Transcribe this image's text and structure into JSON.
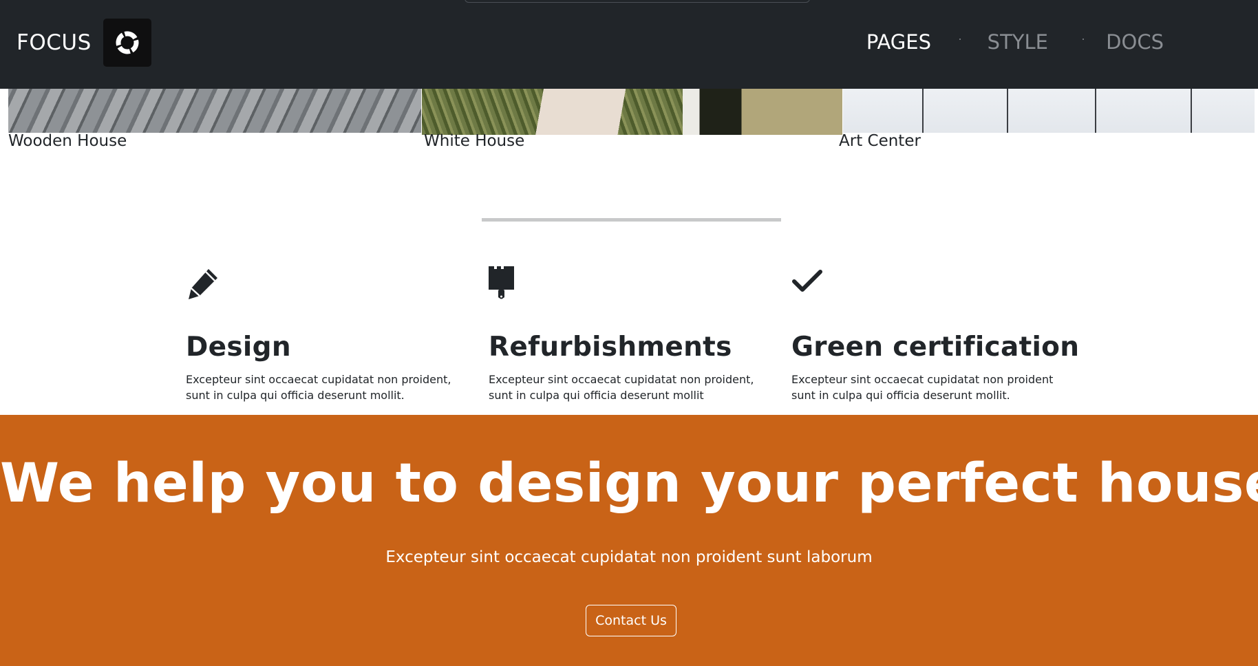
{
  "header": {
    "brand": "FOCUS",
    "nav": [
      {
        "label": "PAGES",
        "active": true
      },
      {
        "label": "STYLE",
        "active": false
      },
      {
        "label": "DOCS",
        "active": false
      }
    ]
  },
  "gallery": {
    "items": [
      {
        "caption": "Wooden House"
      },
      {
        "caption": "White House"
      },
      {
        "caption": "Art Center"
      }
    ]
  },
  "features": [
    {
      "icon": "pencil-icon",
      "title": "Design",
      "text": "Excepteur sint occaecat cupidatat non proident, sunt in culpa qui officia deserunt mollit."
    },
    {
      "icon": "paint-brush-icon",
      "title": "Refurbishments",
      "text": "Excepteur sint occaecat cupidatat non proident, sunt in culpa qui officia deserunt mollit"
    },
    {
      "icon": "checkmark-icon",
      "title": "Green certification",
      "text": "Excepteur sint occaecat cupidatat non proident sunt in culpa qui officia deserunt mollit."
    }
  ],
  "cta": {
    "title": "We help you to design your perfect house",
    "subtitle": "Excepteur sint occaecat cupidatat non proident sunt laborum",
    "button_label": "Contact Us"
  },
  "colors": {
    "header_bg": "#212529",
    "accent": "#c96317",
    "text": "#212529",
    "nav_inactive": "#8a8e93"
  }
}
